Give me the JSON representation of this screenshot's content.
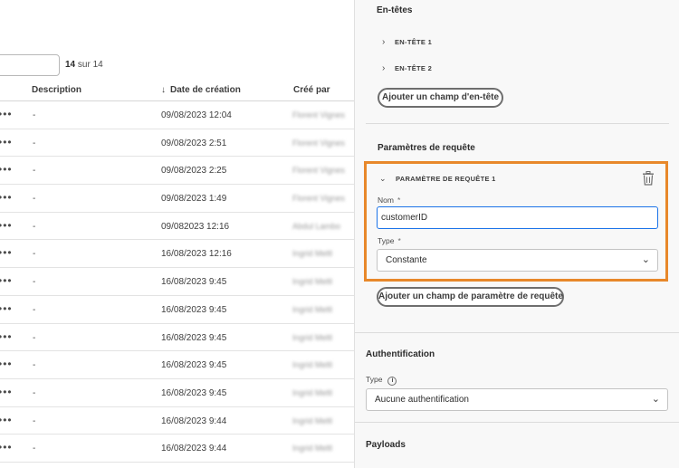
{
  "table": {
    "search_value": "",
    "count_bold": "14",
    "count_rest": "sur 14",
    "columns": {
      "description": "Description",
      "created_date": "Date de création",
      "created_by": "Créé par"
    },
    "rows": [
      {
        "actions": "•••",
        "description": "-",
        "date": "09/08/2023 12:04",
        "by": "Florent Vignes"
      },
      {
        "actions": "•••",
        "description": "-",
        "date": "09/08/2023 2:51",
        "by": "Florent Vignes"
      },
      {
        "actions": "•••",
        "description": "-",
        "date": "09/08/2023 2:25",
        "by": "Florent Vignes"
      },
      {
        "actions": "•••",
        "description": "-",
        "date": "09/08/2023 1:49",
        "by": "Florent Vignes"
      },
      {
        "actions": "•••",
        "description": "-",
        "date": "09/082023 12:16",
        "by": "Abdul Lambo"
      },
      {
        "actions": "•••",
        "description": "-",
        "date": "16/08/2023 12:16",
        "by": "Ingrid Meltl"
      },
      {
        "actions": "•••",
        "description": "-",
        "date": "16/08/2023 9:45",
        "by": "Ingrid Meltl"
      },
      {
        "actions": "•••",
        "description": "-",
        "date": "16/08/2023 9:45",
        "by": "Ingrid Meltl"
      },
      {
        "actions": "•••",
        "description": "-",
        "date": "16/08/2023 9:45",
        "by": "Ingrid Meltl"
      },
      {
        "actions": "•••",
        "description": "-",
        "date": "16/08/2023 9:45",
        "by": "Ingrid Meltl"
      },
      {
        "actions": "•••",
        "description": "-",
        "date": "16/08/2023 9:45",
        "by": "Ingrid Meltl"
      },
      {
        "actions": "•••",
        "description": "-",
        "date": "16/08/2023 9:44",
        "by": "Ingrid Meltl"
      },
      {
        "actions": "•••",
        "description": "-",
        "date": "16/08/2023 9:44",
        "by": "Ingrid Meltl"
      }
    ]
  },
  "panel": {
    "headers": {
      "title": "En-têtes",
      "items": [
        "EN-TÊTE 1",
        "EN-TÊTE 2"
      ],
      "add_button": "Ajouter un champ d'en-tête"
    },
    "query_params": {
      "title": "Paramètres de requête",
      "param_title": "PARAMÈTRE DE REQUÊTE 1",
      "name_label": "Nom",
      "name_value": "customerID",
      "type_label": "Type",
      "type_value": "Constante",
      "required_mark": "*",
      "add_button": "Ajouter un champ de paramètre de requête"
    },
    "auth": {
      "title": "Authentification",
      "type_label": "Type",
      "type_value": "Aucune authentification"
    },
    "payloads": {
      "title": "Payloads"
    },
    "highlight_color": "#e8882a"
  }
}
